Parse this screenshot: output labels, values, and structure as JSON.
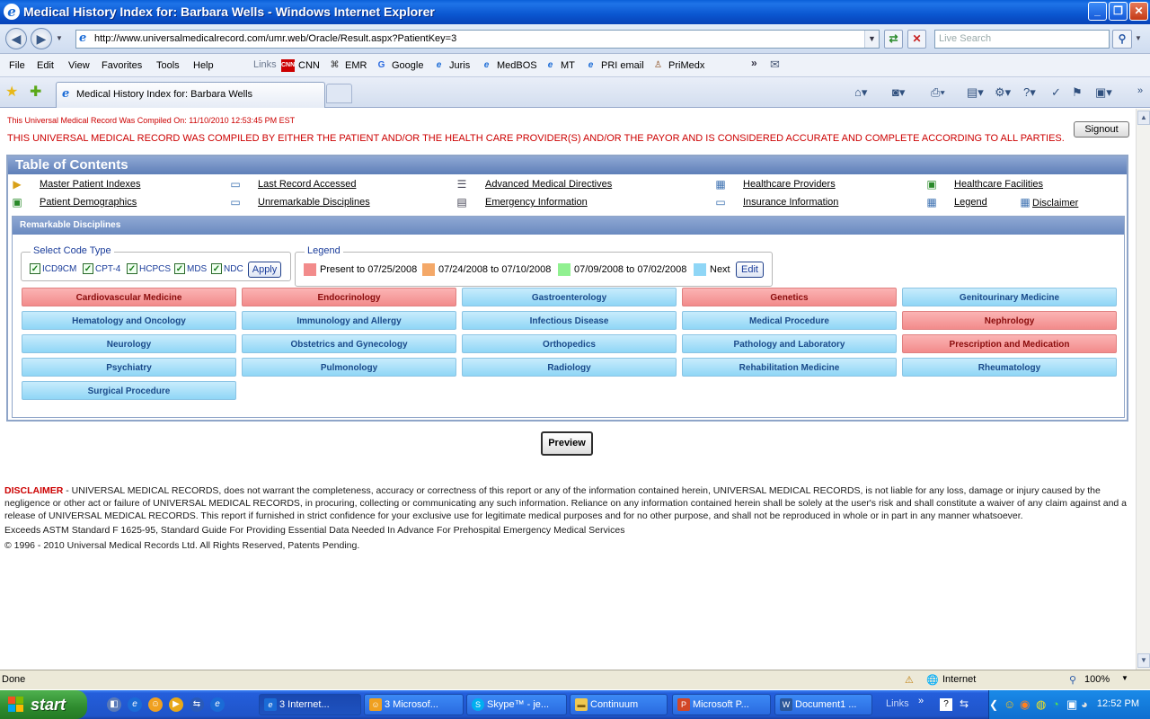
{
  "window": {
    "title": "Medical History Index for: Barbara Wells - Windows Internet Explorer"
  },
  "address_bar": {
    "url": "http://www.universalmedicalrecord.com/umr.web/Oracle/Result.aspx?PatientKey=3",
    "search_placeholder": "Live Search"
  },
  "menu": [
    "File",
    "Edit",
    "View",
    "Favorites",
    "Tools",
    "Help"
  ],
  "links": {
    "label": "Links",
    "items": [
      "CNN",
      "EMR",
      "Google",
      "Juris",
      "MedBOS",
      "MT",
      "PRI email",
      "PriMedx"
    ]
  },
  "tab": {
    "title": "Medical History Index for: Barbara Wells"
  },
  "page": {
    "compiled_on": "This Universal Medical Record Was Compiled On: 11/10/2010 12:53:45 PM EST",
    "warning": "THIS UNIVERSAL MEDICAL RECORD WAS COMPILED BY EITHER THE PATIENT AND/OR THE HEALTH CARE PROVIDER(S) AND/OR THE PAYOR AND IS CONSIDERED ACCURATE AND COMPLETE ACCORDING TO ALL PARTIES.",
    "signout": "Signout",
    "toc_title": "Table of Contents",
    "toc": [
      "Master Patient Indexes",
      "Last Record Accessed",
      "Advanced Medical Directives",
      "Healthcare Providers",
      "Healthcare Facilities",
      "Patient Demographics",
      "Unremarkable Disciplines",
      "Emergency Information",
      "Insurance Information",
      "Legend",
      "Disclaimer"
    ],
    "remarkable_title": "Remarkable Disciplines",
    "code_type": {
      "title": "Select Code Type",
      "options": [
        "ICD9CM",
        "CPT-4",
        "HCPCS",
        "MDS",
        "NDC"
      ],
      "apply": "Apply"
    },
    "legend": {
      "title": "Legend",
      "items": [
        {
          "label": "Present to 07/25/2008",
          "color": "#f28b8b"
        },
        {
          "label": "07/24/2008 to 07/10/2008",
          "color": "#f4a868"
        },
        {
          "label": "07/09/2008 to 07/02/2008",
          "color": "#90f090"
        },
        {
          "label": "Next",
          "color": "#8fd6f6"
        }
      ],
      "edit": "Edit"
    },
    "disciplines": [
      {
        "label": "Cardiovascular Medicine",
        "status": "red"
      },
      {
        "label": "Endocrinology",
        "status": "red"
      },
      {
        "label": "Gastroenterology",
        "status": "blue"
      },
      {
        "label": "Genetics",
        "status": "red"
      },
      {
        "label": "Genitourinary Medicine",
        "status": "blue"
      },
      {
        "label": "Hematology and Oncology",
        "status": "blue"
      },
      {
        "label": "Immunology and Allergy",
        "status": "blue"
      },
      {
        "label": "Infectious Disease",
        "status": "blue"
      },
      {
        "label": "Medical Procedure",
        "status": "blue"
      },
      {
        "label": "Nephrology",
        "status": "red"
      },
      {
        "label": "Neurology",
        "status": "blue"
      },
      {
        "label": "Obstetrics and Gynecology",
        "status": "blue"
      },
      {
        "label": "Orthopedics",
        "status": "blue"
      },
      {
        "label": "Pathology and Laboratory",
        "status": "blue"
      },
      {
        "label": "Prescription and Medication",
        "status": "red"
      },
      {
        "label": "Psychiatry",
        "status": "blue"
      },
      {
        "label": "Pulmonology",
        "status": "blue"
      },
      {
        "label": "Radiology",
        "status": "blue"
      },
      {
        "label": "Rehabilitation Medicine",
        "status": "blue"
      },
      {
        "label": "Rheumatology",
        "status": "blue"
      },
      {
        "label": "Surgical Procedure",
        "status": "blue"
      }
    ],
    "preview": "Preview",
    "disclaimer_label": "DISCLAIMER",
    "disclaimer_text": " - UNIVERSAL MEDICAL RECORDS, does not warrant the completeness, accuracy or correctness of this report or any of the information contained herein, UNIVERSAL MEDICAL RECORDS, is not liable for any loss, damage or injury caused by the negligence or other act or failure of UNIVERSAL MEDICAL RECORDS, in procuring, collecting or communicating any such information. Reliance on any information contained herein shall be solely at the user's risk and shall constitute a waiver of any claim against and a release of UNIVERSAL MEDICAL RECORDS. This report if furnished in strict confidence for your exclusive use for legitimate medical purposes and for no other purpose, and shall not be reproduced in whole or in part in any manner whatsoever.",
    "astm": "Exceeds ASTM Standard F 1625-95, Standard Guide For Providing Essential Data Needed In Advance For Prehospital Emergency Medical Services",
    "copyright": "© 1996 - 2010 Universal Medical Records Ltd. All Rights Reserved, Patents Pending."
  },
  "status": {
    "left": "Done",
    "zone": "Internet",
    "zoom": "100%"
  },
  "taskbar": {
    "start": "start",
    "buttons": [
      "3 Internet...",
      "3 Microsof...",
      "Skype™ - je...",
      "Continuum",
      "Microsoft P...",
      "Document1 ..."
    ],
    "links": "Links",
    "clock": "12:52 PM"
  }
}
